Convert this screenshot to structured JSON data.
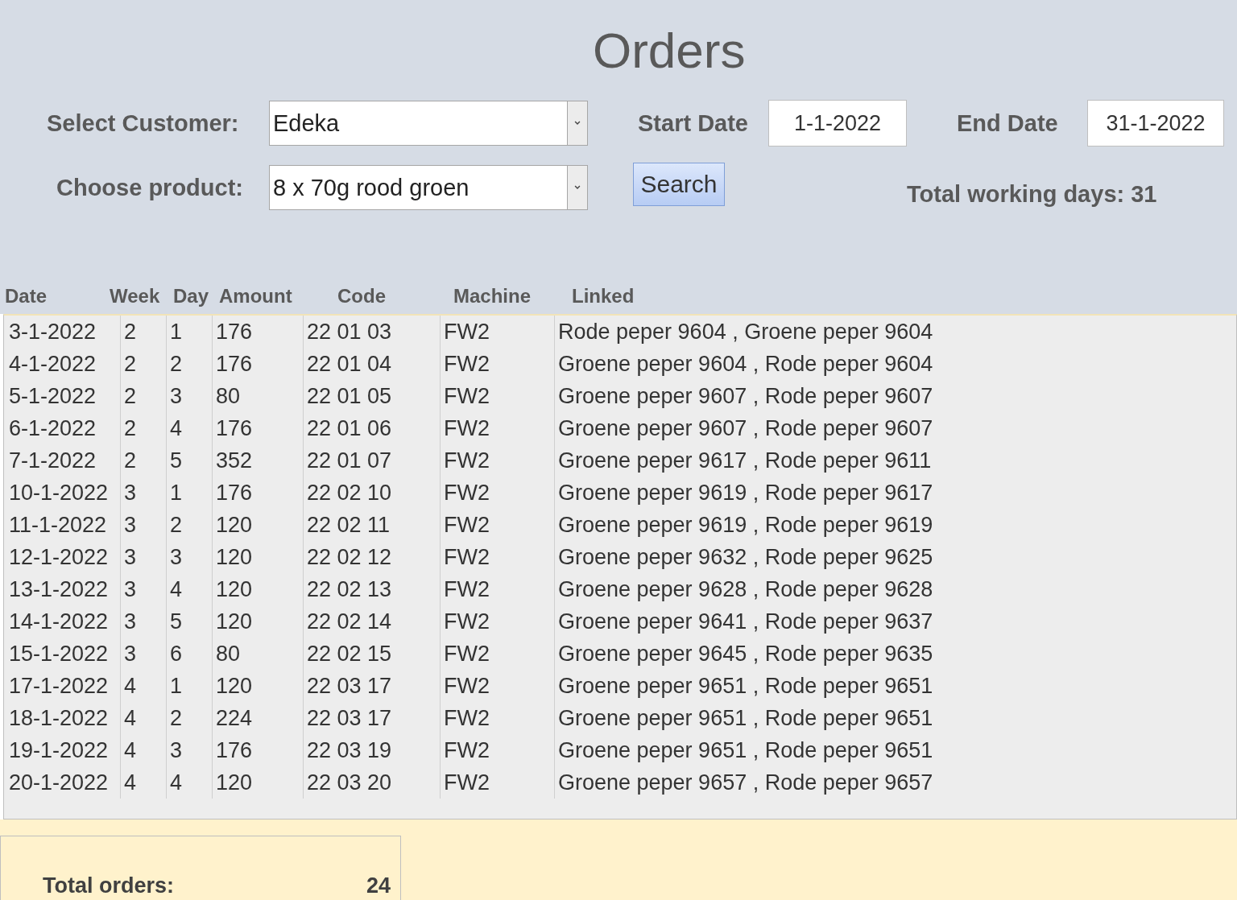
{
  "title": "Orders",
  "filters": {
    "customer_label": "Select Customer:",
    "customer": "Edeka",
    "start_label": "Start Date",
    "start": "1-1-2022",
    "end_label": "End Date",
    "end": "31-1-2022",
    "product_label": "Choose product:",
    "product": "8 x 70g rood groen",
    "search_button": "Search",
    "working_days": "Total working days: 31"
  },
  "table": {
    "columns": [
      "Date",
      "Week",
      "Day",
      "Amount",
      "Code",
      "Machine",
      "Linked"
    ],
    "rows": [
      [
        "3-1-2022",
        "2",
        "1",
        "176",
        "22 01 03",
        "FW2",
        "Rode peper 9604 , Groene peper 9604"
      ],
      [
        "4-1-2022",
        "2",
        "2",
        "176",
        "22 01 04",
        "FW2",
        "Groene peper 9604 , Rode peper 9604"
      ],
      [
        "5-1-2022",
        "2",
        "3",
        "80",
        "22 01 05",
        "FW2",
        "Groene peper 9607 , Rode peper 9607"
      ],
      [
        "6-1-2022",
        "2",
        "4",
        "176",
        "22 01 06",
        "FW2",
        "Groene peper 9607 , Rode peper 9607"
      ],
      [
        "7-1-2022",
        "2",
        "5",
        "352",
        "22 01 07",
        "FW2",
        "Groene peper 9617 , Rode peper 9611"
      ],
      [
        "10-1-2022",
        "3",
        "1",
        "176",
        "22 02 10",
        "FW2",
        "Groene peper 9619 , Rode peper 9617"
      ],
      [
        "11-1-2022",
        "3",
        "2",
        "120",
        "22 02 11",
        "FW2",
        "Groene peper 9619 , Rode peper 9619"
      ],
      [
        "12-1-2022",
        "3",
        "3",
        "120",
        "22 02 12",
        "FW2",
        "Groene peper 9632 , Rode peper 9625"
      ],
      [
        "13-1-2022",
        "3",
        "4",
        "120",
        "22 02 13",
        "FW2",
        "Groene peper 9628 , Rode peper 9628"
      ],
      [
        "14-1-2022",
        "3",
        "5",
        "120",
        "22 02 14",
        "FW2",
        "Groene peper 9641 , Rode peper 9637"
      ],
      [
        "15-1-2022",
        "3",
        "6",
        "80",
        "22 02 15",
        "FW2",
        "Groene peper 9645 , Rode peper 9635"
      ],
      [
        "17-1-2022",
        "4",
        "1",
        "120",
        "22 03 17",
        "FW2",
        "Groene peper 9651 , Rode peper 9651"
      ],
      [
        "18-1-2022",
        "4",
        "2",
        "224",
        "22 03 17",
        "FW2",
        "Groene peper 9651 , Rode peper 9651"
      ],
      [
        "19-1-2022",
        "4",
        "3",
        "176",
        "22 03 19",
        "FW2",
        "Groene peper 9651 , Rode peper 9651"
      ],
      [
        "20-1-2022",
        "4",
        "4",
        "120",
        "22 03 20",
        "FW2",
        "Groene peper 9657 , Rode peper 9657"
      ]
    ]
  },
  "footer": {
    "label": "Total orders:",
    "value": "24"
  }
}
